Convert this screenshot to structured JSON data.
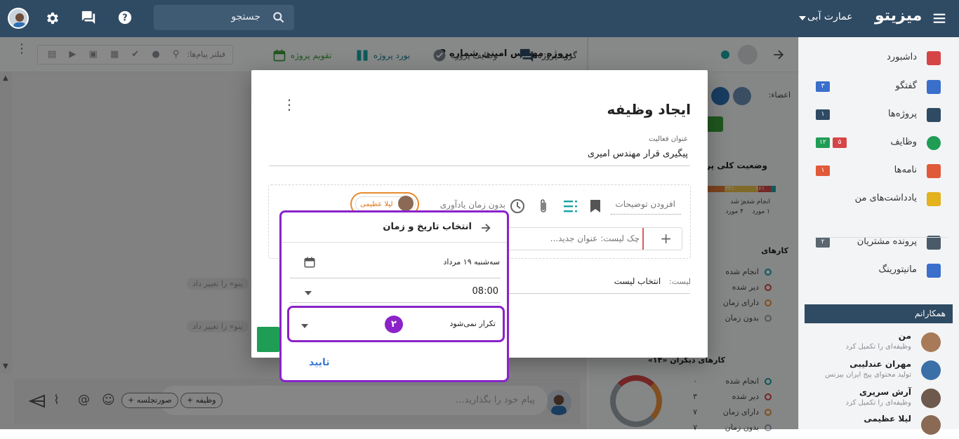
{
  "topbar": {
    "brand": "میزیتو",
    "company": "عمارت آبی",
    "search_placeholder": "جستجو",
    "icons": [
      "menu-icon",
      "chevron-down-icon",
      "search-icon",
      "help-icon",
      "chat-icon",
      "gear-icon",
      "avatar"
    ]
  },
  "sidebar": {
    "items": [
      {
        "label": "داشبورد",
        "icon": "home-icon",
        "color": "#d64545"
      },
      {
        "label": "گفتگو",
        "icon": "chat-icon",
        "color": "#3a6fcb",
        "badges": [
          {
            "text": "۳",
            "color": "#3a6fcb"
          }
        ]
      },
      {
        "label": "پروژه‌ها",
        "icon": "projects-icon",
        "color": "#2f4a63",
        "badges": [
          {
            "text": "۱",
            "color": "#2f4a63"
          }
        ]
      },
      {
        "label": "وظایف",
        "icon": "task-icon",
        "color": "#1f9d55",
        "badges": [
          {
            "text": "۱۲",
            "color": "#1f9d55"
          },
          {
            "text": "۵",
            "color": "#d64545"
          }
        ]
      },
      {
        "label": "نامه‌ها",
        "icon": "mail-icon",
        "color": "#e05a3a",
        "badges": [
          {
            "text": "۱",
            "color": "#e05a3a"
          }
        ]
      },
      {
        "label": "یادداشت‌های من",
        "icon": "notes-icon",
        "color": "#e3b21c"
      },
      {
        "label": "پرونده مشتریان",
        "icon": "contacts-icon",
        "color": "#4a5a68",
        "badges": [
          {
            "text": "۲",
            "color": "#5b6670"
          }
        ]
      },
      {
        "label": "مانیتورینگ",
        "icon": "chart-icon",
        "color": "#3a6fcb"
      }
    ],
    "colleagues_title": "همکارانم",
    "colleagues": [
      {
        "name": "من",
        "status": "وظیفه‌ای را تکمیل کرد"
      },
      {
        "name": "مهران عندلیبی",
        "status": "تولید محتوای پیج ایران بیزنس"
      },
      {
        "name": "آرش سریری",
        "status": "وظیفه‌ای را تکمیل کرد"
      },
      {
        "name": "لیلا عظیمی",
        "status": ""
      }
    ]
  },
  "project_bar": {
    "project_title": "پروژه مهندس امینی شماره 2",
    "tabs": [
      {
        "label": "گروه پروژه",
        "icon": "chat-icon"
      },
      {
        "label": "وظایف پروژه",
        "icon": "check-circle-icon"
      },
      {
        "label": "بورد پروژه",
        "icon": "board-icon"
      },
      {
        "label": "تقویم پروژه",
        "icon": "calendar-icon"
      }
    ],
    "filter_placeholder": "فیلتر پیام‌ها:"
  },
  "mid_panel": {
    "members_label": "اعضاء:",
    "status_title": "وضعیت کلی پروژه",
    "my_tasks_title": "کارهای",
    "legend": [
      "انجام شده",
      "دیر شده",
      "دارای زمان",
      "بدون زمان"
    ],
    "others_title": "کارهای دیگران «۱۴»",
    "others_values": [
      "۰",
      "۳",
      "۷",
      "۷"
    ],
    "bar_stats": [
      "۱۶٪",
      "۳۳٪"
    ],
    "stat_labels": [
      "انجام شده:",
      "دیر شد"
    ],
    "stat_values": [
      "۱ مورد",
      "۴ مورد"
    ]
  },
  "chat": {
    "system_messages": [
      "ینو» را تغییر داد",
      "ینو» را تغییر داد"
    ],
    "composer_placeholder": "پیام خود را بگذارید...",
    "chip_task": "+ وظیفه",
    "chip_minutes": "+ صورتجلسه"
  },
  "dialog": {
    "title": "ایجاد وظیفه",
    "activity_label": "عنوان فعالیت",
    "activity_value": "پیگیری قرار مهندس امیری",
    "description_placeholder": "افزودن توضیحات",
    "reminder_text": "بدون زمان یادآوری",
    "assignee": "لیلا عظیمی",
    "checklist_placeholder": "چک لیست: عنوان جدید...",
    "list_label": "لیست:",
    "list_value": "انتخاب لیست"
  },
  "datetime_picker": {
    "title": "انتخاب تاریخ و زمان",
    "date": "سه‌شنبه ۱۹ مرداد",
    "time": "08:00",
    "repeat": "تکرار نمی‌شود",
    "step_number": "۲",
    "confirm": "تایید"
  },
  "colors": {
    "topbar": "#2f4a63",
    "accent_purple": "#8b23c9",
    "green": "#1f9d55",
    "confirm_blue": "#3a7bd5"
  }
}
